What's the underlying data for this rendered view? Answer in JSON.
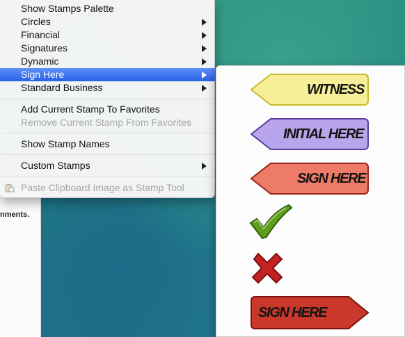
{
  "menu": {
    "items": [
      {
        "label": "Show Stamps Palette"
      },
      {
        "label": "Circles"
      },
      {
        "label": "Financial"
      },
      {
        "label": "Signatures"
      },
      {
        "label": "Dynamic"
      },
      {
        "label": "Sign Here"
      },
      {
        "label": "Standard Business"
      },
      {
        "label": "Add Current Stamp To Favorites"
      },
      {
        "label": "Remove Current Stamp From Favorites"
      },
      {
        "label": "Show Stamp Names"
      },
      {
        "label": "Custom Stamps"
      },
      {
        "label": "Paste Clipboard Image as Stamp Tool"
      }
    ]
  },
  "stamps": [
    {
      "label": "WITNESS",
      "fill": "#f7ef98",
      "stroke": "#c9ba2a"
    },
    {
      "label": "INITIAL HERE",
      "fill": "#b8a5ec",
      "stroke": "#5a3d9e"
    },
    {
      "label": "SIGN HERE",
      "fill": "#ee7a68",
      "stroke": "#9b2418"
    },
    {
      "label": "SIGN HERE",
      "fill": "#c9382b",
      "stroke": "#7a150e"
    }
  ],
  "colors": {
    "highlight": "#3b73ef",
    "check": "#5f9d1f",
    "cross": "#c42222"
  },
  "document": {
    "text": "nments."
  }
}
